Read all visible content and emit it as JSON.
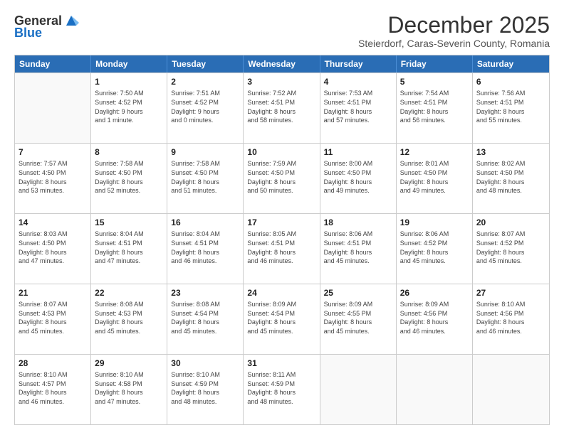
{
  "header": {
    "logo": {
      "line1": "General",
      "line2": "Blue"
    },
    "title": "December 2025",
    "subtitle": "Steierdorf, Caras-Severin County, Romania"
  },
  "calendar": {
    "days": [
      "Sunday",
      "Monday",
      "Tuesday",
      "Wednesday",
      "Thursday",
      "Friday",
      "Saturday"
    ],
    "rows": [
      [
        {
          "day": "",
          "info": ""
        },
        {
          "day": "1",
          "info": "Sunrise: 7:50 AM\nSunset: 4:52 PM\nDaylight: 9 hours\nand 1 minute."
        },
        {
          "day": "2",
          "info": "Sunrise: 7:51 AM\nSunset: 4:52 PM\nDaylight: 9 hours\nand 0 minutes."
        },
        {
          "day": "3",
          "info": "Sunrise: 7:52 AM\nSunset: 4:51 PM\nDaylight: 8 hours\nand 58 minutes."
        },
        {
          "day": "4",
          "info": "Sunrise: 7:53 AM\nSunset: 4:51 PM\nDaylight: 8 hours\nand 57 minutes."
        },
        {
          "day": "5",
          "info": "Sunrise: 7:54 AM\nSunset: 4:51 PM\nDaylight: 8 hours\nand 56 minutes."
        },
        {
          "day": "6",
          "info": "Sunrise: 7:56 AM\nSunset: 4:51 PM\nDaylight: 8 hours\nand 55 minutes."
        }
      ],
      [
        {
          "day": "7",
          "info": "Sunrise: 7:57 AM\nSunset: 4:50 PM\nDaylight: 8 hours\nand 53 minutes."
        },
        {
          "day": "8",
          "info": "Sunrise: 7:58 AM\nSunset: 4:50 PM\nDaylight: 8 hours\nand 52 minutes."
        },
        {
          "day": "9",
          "info": "Sunrise: 7:58 AM\nSunset: 4:50 PM\nDaylight: 8 hours\nand 51 minutes."
        },
        {
          "day": "10",
          "info": "Sunrise: 7:59 AM\nSunset: 4:50 PM\nDaylight: 8 hours\nand 50 minutes."
        },
        {
          "day": "11",
          "info": "Sunrise: 8:00 AM\nSunset: 4:50 PM\nDaylight: 8 hours\nand 49 minutes."
        },
        {
          "day": "12",
          "info": "Sunrise: 8:01 AM\nSunset: 4:50 PM\nDaylight: 8 hours\nand 49 minutes."
        },
        {
          "day": "13",
          "info": "Sunrise: 8:02 AM\nSunset: 4:50 PM\nDaylight: 8 hours\nand 48 minutes."
        }
      ],
      [
        {
          "day": "14",
          "info": "Sunrise: 8:03 AM\nSunset: 4:50 PM\nDaylight: 8 hours\nand 47 minutes."
        },
        {
          "day": "15",
          "info": "Sunrise: 8:04 AM\nSunset: 4:51 PM\nDaylight: 8 hours\nand 47 minutes."
        },
        {
          "day": "16",
          "info": "Sunrise: 8:04 AM\nSunset: 4:51 PM\nDaylight: 8 hours\nand 46 minutes."
        },
        {
          "day": "17",
          "info": "Sunrise: 8:05 AM\nSunset: 4:51 PM\nDaylight: 8 hours\nand 46 minutes."
        },
        {
          "day": "18",
          "info": "Sunrise: 8:06 AM\nSunset: 4:51 PM\nDaylight: 8 hours\nand 45 minutes."
        },
        {
          "day": "19",
          "info": "Sunrise: 8:06 AM\nSunset: 4:52 PM\nDaylight: 8 hours\nand 45 minutes."
        },
        {
          "day": "20",
          "info": "Sunrise: 8:07 AM\nSunset: 4:52 PM\nDaylight: 8 hours\nand 45 minutes."
        }
      ],
      [
        {
          "day": "21",
          "info": "Sunrise: 8:07 AM\nSunset: 4:53 PM\nDaylight: 8 hours\nand 45 minutes."
        },
        {
          "day": "22",
          "info": "Sunrise: 8:08 AM\nSunset: 4:53 PM\nDaylight: 8 hours\nand 45 minutes."
        },
        {
          "day": "23",
          "info": "Sunrise: 8:08 AM\nSunset: 4:54 PM\nDaylight: 8 hours\nand 45 minutes."
        },
        {
          "day": "24",
          "info": "Sunrise: 8:09 AM\nSunset: 4:54 PM\nDaylight: 8 hours\nand 45 minutes."
        },
        {
          "day": "25",
          "info": "Sunrise: 8:09 AM\nSunset: 4:55 PM\nDaylight: 8 hours\nand 45 minutes."
        },
        {
          "day": "26",
          "info": "Sunrise: 8:09 AM\nSunset: 4:56 PM\nDaylight: 8 hours\nand 46 minutes."
        },
        {
          "day": "27",
          "info": "Sunrise: 8:10 AM\nSunset: 4:56 PM\nDaylight: 8 hours\nand 46 minutes."
        }
      ],
      [
        {
          "day": "28",
          "info": "Sunrise: 8:10 AM\nSunset: 4:57 PM\nDaylight: 8 hours\nand 46 minutes."
        },
        {
          "day": "29",
          "info": "Sunrise: 8:10 AM\nSunset: 4:58 PM\nDaylight: 8 hours\nand 47 minutes."
        },
        {
          "day": "30",
          "info": "Sunrise: 8:10 AM\nSunset: 4:59 PM\nDaylight: 8 hours\nand 48 minutes."
        },
        {
          "day": "31",
          "info": "Sunrise: 8:11 AM\nSunset: 4:59 PM\nDaylight: 8 hours\nand 48 minutes."
        },
        {
          "day": "",
          "info": ""
        },
        {
          "day": "",
          "info": ""
        },
        {
          "day": "",
          "info": ""
        }
      ]
    ]
  }
}
